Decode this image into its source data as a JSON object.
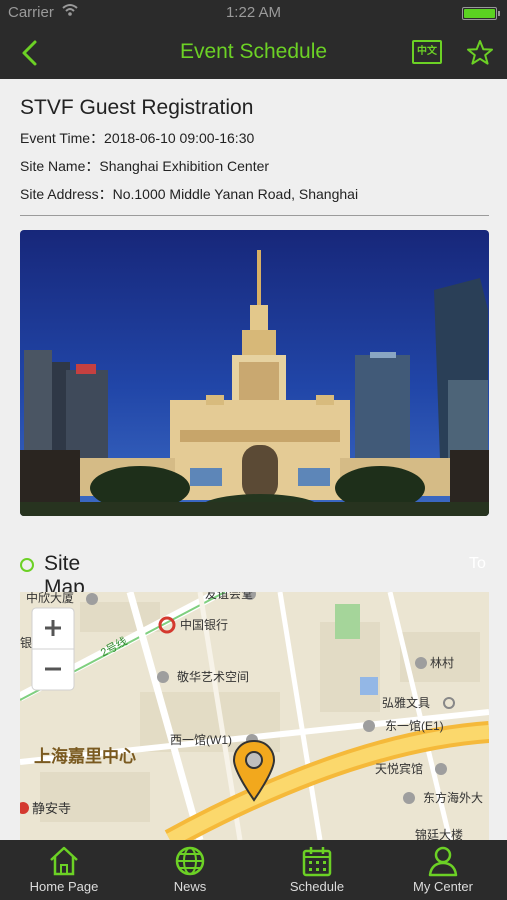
{
  "status_bar": {
    "carrier": "Carrier",
    "time": "1:22 AM"
  },
  "navbar": {
    "title": "Event Schedule",
    "language_label": "中文",
    "accent_color": "#6cd125"
  },
  "event": {
    "title": "STVF Guest Registration",
    "time_label": "Event Time：",
    "time_value": "2018-06-10 09:00-16:30",
    "site_name_label": "Site Name：",
    "site_name_value": "Shanghai Exhibition Center",
    "site_address_label": "Site Address：",
    "site_address_value": "No.1000 Middle Yanan Road, Shanghai"
  },
  "site_map": {
    "heading": "Site Map",
    "hint": "To",
    "labels": [
      "中欣大厦",
      "友谊会堂",
      "中国银行",
      "2号线",
      "银行",
      "林村",
      "敬华艺术空间",
      "弘雅文具",
      "东一馆(E1)",
      "西一馆(W1)",
      "上海嘉里中心",
      "天悦宾馆",
      "静安寺",
      "东方海外大",
      "锦廷大楼"
    ]
  },
  "tabs": [
    {
      "label": "Home Page",
      "icon": "home-icon"
    },
    {
      "label": "News",
      "icon": "globe-icon"
    },
    {
      "label": "Schedule",
      "icon": "calendar-icon"
    },
    {
      "label": "My Center",
      "icon": "user-icon"
    }
  ]
}
